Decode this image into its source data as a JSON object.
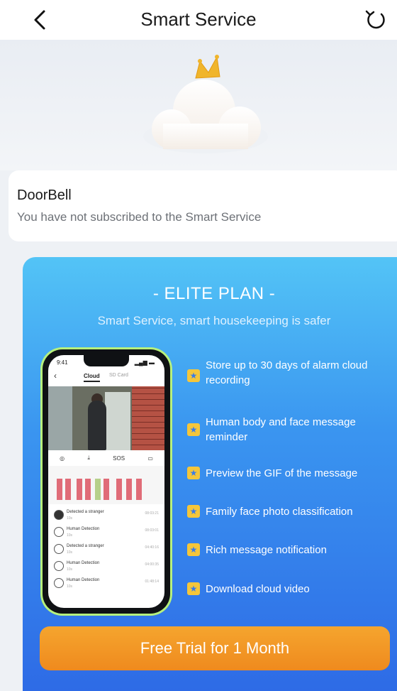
{
  "header": {
    "title": "Smart Service",
    "back_icon": "chevron-left-icon",
    "refresh_icon": "refresh-icon"
  },
  "hero": {
    "icon": "crowned-cloud-icon"
  },
  "status": {
    "device_name": "DoorBell",
    "message": "You have not subscribed to the Smart Service"
  },
  "plan": {
    "title": "- ELITE PLAN -",
    "subtitle": "Smart Service, smart housekeeping is safer",
    "features": [
      "Store up to 30 days of alarm cloud recording",
      "Human body and face message reminder",
      "Preview the GIF of the message",
      "Family face photo classification",
      "Rich message notification",
      "Download cloud video"
    ],
    "cta_label": "Free Trial for 1 Month"
  },
  "colors": {
    "plan_gradient_top": "#53c4f6",
    "plan_gradient_bottom": "#2e6be6",
    "cta": "#f39a25",
    "star": "#f5c63a"
  }
}
